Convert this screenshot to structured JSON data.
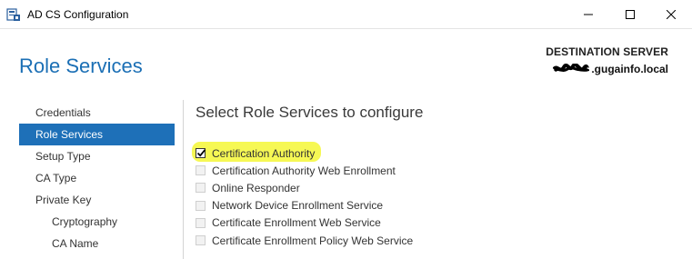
{
  "window": {
    "title": "AD CS Configuration"
  },
  "header": {
    "page_title": "Role Services",
    "destination_label": "DESTINATION SERVER",
    "server_name": ".gugainfo.local"
  },
  "sidebar": {
    "items": [
      {
        "label": "Credentials",
        "active": false,
        "sub": false
      },
      {
        "label": "Role Services",
        "active": true,
        "sub": false
      },
      {
        "label": "Setup Type",
        "active": false,
        "sub": false
      },
      {
        "label": "CA Type",
        "active": false,
        "sub": false
      },
      {
        "label": "Private Key",
        "active": false,
        "sub": false
      },
      {
        "label": "Cryptography",
        "active": false,
        "sub": true
      },
      {
        "label": "CA Name",
        "active": false,
        "sub": true
      }
    ]
  },
  "main": {
    "section_title": "Select Role Services to configure",
    "role_services": [
      {
        "label": "Certification Authority",
        "checked": true,
        "enabled": true
      },
      {
        "label": "Certification Authority Web Enrollment",
        "checked": false,
        "enabled": false
      },
      {
        "label": "Online Responder",
        "checked": false,
        "enabled": false
      },
      {
        "label": "Network Device Enrollment Service",
        "checked": false,
        "enabled": false
      },
      {
        "label": "Certificate Enrollment Web Service",
        "checked": false,
        "enabled": false
      },
      {
        "label": "Certificate Enrollment Policy Web Service",
        "checked": false,
        "enabled": false
      }
    ]
  },
  "colors": {
    "accent": "#1e70b8",
    "heading": "#1b6fb5",
    "highlight": "#f6f84b"
  },
  "icons": {
    "app": "server-icon",
    "minimize": "minimize-icon",
    "maximize": "maximize-icon",
    "close": "close-icon"
  }
}
